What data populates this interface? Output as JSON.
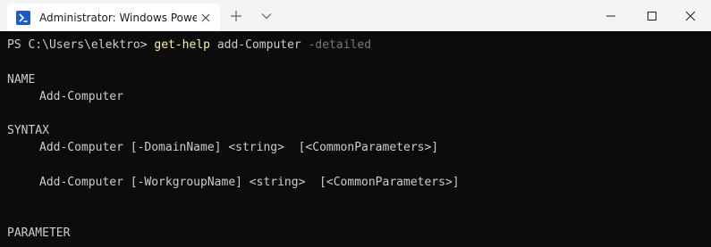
{
  "window": {
    "tab_title": "Administrator: Windows PowerShell",
    "new_tab_glyph": "+",
    "icon": "powershell-icon"
  },
  "terminal": {
    "prompt": "PS C:\\Users\\elektro> ",
    "command": "get-help",
    "argument": " add-Computer ",
    "flag": "-detailed",
    "sections": {
      "name_header": "NAME",
      "name_value": "Add-Computer",
      "syntax_header": "SYNTAX",
      "syntax_line_1": "Add-Computer [-DomainName] <string>  [<CommonParameters>]",
      "syntax_line_2": "Add-Computer [-WorkgroupName] <string>  [<CommonParameters>]",
      "parameter_header": "PARAMETER"
    }
  },
  "colors": {
    "background": "#0c0c0c",
    "foreground": "#cccccc",
    "command": "#f9f1a5",
    "parameter": "#767676",
    "titlebar": "#f3f3f3"
  }
}
